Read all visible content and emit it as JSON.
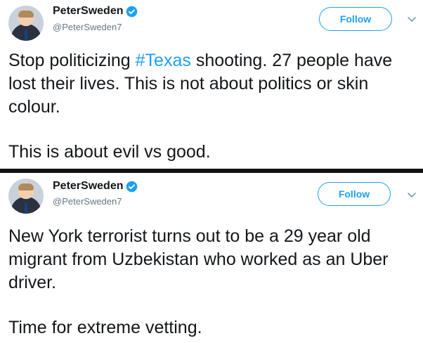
{
  "tweets": [
    {
      "author": {
        "display_name": "PeterSweden",
        "handle": "@PeterSweden7"
      },
      "follow_label": "Follow",
      "text": {
        "line1_pre": "Stop politicizing ",
        "hashtag": "#Texas",
        "line1_post": " shooting. 27 people have lost their lives. This is not about politics or skin colour.",
        "paragraph2": "This is about evil vs good."
      }
    },
    {
      "author": {
        "display_name": "PeterSweden",
        "handle": "@PeterSweden7"
      },
      "follow_label": "Follow",
      "text": {
        "paragraph1": "New York terrorist turns out to be a 29 year old migrant from Uzbekistan who worked as an Uber driver.",
        "paragraph2": "Time for extreme vetting."
      }
    }
  ],
  "colors": {
    "accent": "#1da1f2",
    "text": "#14171a",
    "muted": "#657786",
    "divider": "#111111"
  },
  "icons": {
    "verified": "verified-badge-icon",
    "chevron": "chevron-down-icon"
  }
}
